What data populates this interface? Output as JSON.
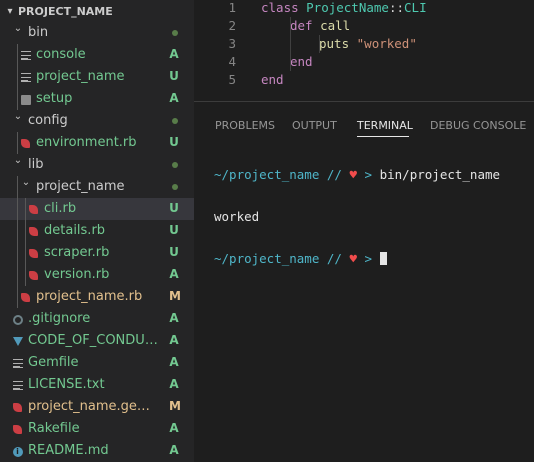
{
  "explorer": {
    "root": "PROJECT_NAME",
    "tree": [
      {
        "name": "bin",
        "kind": "folder",
        "depth": 0,
        "open": true,
        "dot": true
      },
      {
        "name": "console",
        "kind": "lines",
        "depth": 1,
        "badge": "A",
        "status": "added"
      },
      {
        "name": "project_name",
        "kind": "lines",
        "depth": 1,
        "badge": "U",
        "status": "untracked"
      },
      {
        "name": "setup",
        "kind": "setup",
        "depth": 1,
        "badge": "A",
        "status": "added"
      },
      {
        "name": "config",
        "kind": "folder",
        "depth": 0,
        "open": true,
        "dot": true
      },
      {
        "name": "environment.rb",
        "kind": "ruby",
        "depth": 1,
        "badge": "U",
        "status": "untracked"
      },
      {
        "name": "lib",
        "kind": "folder",
        "depth": 0,
        "open": true,
        "dot": true
      },
      {
        "name": "project_name",
        "kind": "folder",
        "depth": 1,
        "open": true,
        "dot": true
      },
      {
        "name": "cli.rb",
        "kind": "ruby",
        "depth": 2,
        "badge": "U",
        "status": "untracked",
        "selected": true
      },
      {
        "name": "details.rb",
        "kind": "ruby",
        "depth": 2,
        "badge": "U",
        "status": "untracked"
      },
      {
        "name": "scraper.rb",
        "kind": "ruby",
        "depth": 2,
        "badge": "U",
        "status": "untracked"
      },
      {
        "name": "version.rb",
        "kind": "ruby",
        "depth": 2,
        "badge": "A",
        "status": "added"
      },
      {
        "name": "project_name.rb",
        "kind": "ruby",
        "depth": 1,
        "badge": "M",
        "status": "modified"
      },
      {
        "name": ".gitignore",
        "kind": "gear",
        "depth": 0,
        "badge": "A",
        "status": "added"
      },
      {
        "name": "CODE_OF_CONDUCT....",
        "kind": "down",
        "depth": 0,
        "badge": "A",
        "status": "added"
      },
      {
        "name": "Gemfile",
        "kind": "lines",
        "depth": 0,
        "badge": "A",
        "status": "added"
      },
      {
        "name": "LICENSE.txt",
        "kind": "lines",
        "depth": 0,
        "badge": "A",
        "status": "added"
      },
      {
        "name": "project_name.gemspec",
        "kind": "ruby",
        "depth": 0,
        "badge": "M",
        "status": "modified"
      },
      {
        "name": "Rakefile",
        "kind": "ruby",
        "depth": 0,
        "badge": "A",
        "status": "added"
      },
      {
        "name": "README.md",
        "kind": "readme",
        "depth": 0,
        "badge": "A",
        "status": "added"
      }
    ]
  },
  "editor": {
    "lines": [
      {
        "num": "1",
        "indent": 0,
        "tokens": [
          [
            "kw",
            "class "
          ],
          [
            "cls",
            "ProjectName"
          ],
          [
            "plain",
            "::"
          ],
          [
            "cls",
            "CLI"
          ]
        ]
      },
      {
        "num": "2",
        "indent": 1,
        "tokens": [
          [
            "kw",
            "def "
          ],
          [
            "fn",
            "call"
          ]
        ]
      },
      {
        "num": "3",
        "indent": 2,
        "tokens": [
          [
            "fn",
            "puts "
          ],
          [
            "str",
            "\"worked\""
          ]
        ]
      },
      {
        "num": "4",
        "indent": 1,
        "tokens": [
          [
            "kw",
            "end"
          ]
        ]
      },
      {
        "num": "5",
        "indent": 0,
        "tokens": [
          [
            "kw",
            "end"
          ]
        ]
      }
    ]
  },
  "panel": {
    "tabs": [
      "PROBLEMS",
      "OUTPUT",
      "TERMINAL",
      "DEBUG CONSOLE"
    ],
    "active_tab": "TERMINAL",
    "terminal": {
      "prompt_path": "~/project_name",
      "prompt_sep": "//",
      "prompt_heart": "♥",
      "prompt_gt": ">",
      "command": "bin/project_name",
      "output": "worked"
    }
  },
  "colors": {
    "added_untracked": "#73c991",
    "modified": "#e2c08d",
    "ruby_icon": "#cc3e44",
    "keyword": "#c586c0",
    "class_name": "#4ec9b0",
    "function": "#dcdcaa",
    "string": "#ce9178"
  }
}
